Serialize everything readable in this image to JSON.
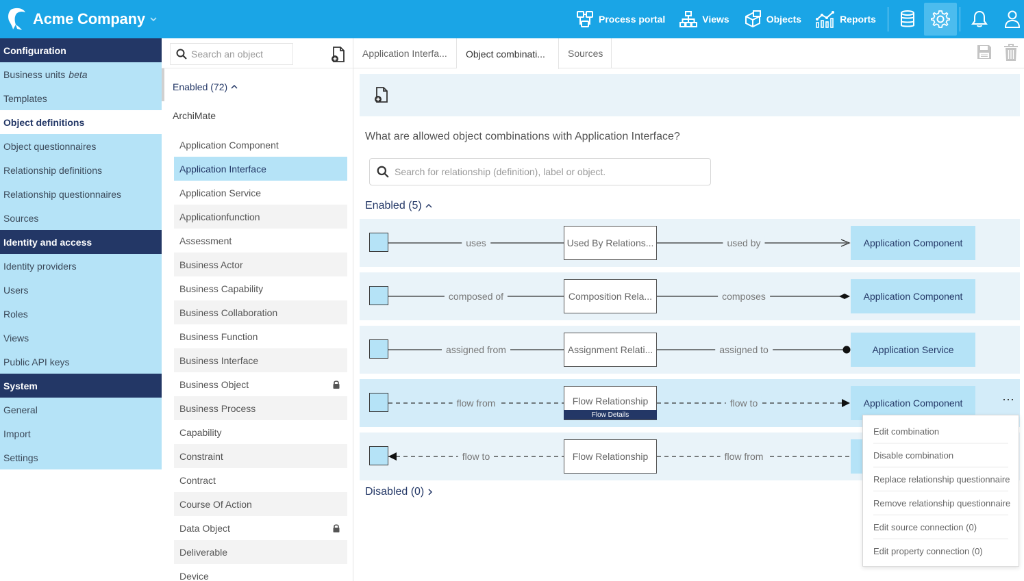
{
  "header": {
    "company": "Acme Company",
    "nav": [
      {
        "label": "Process portal",
        "icon": "process-portal-icon"
      },
      {
        "label": "Views",
        "icon": "views-icon"
      },
      {
        "label": "Objects",
        "icon": "objects-icon"
      },
      {
        "label": "Reports",
        "icon": "reports-icon"
      }
    ],
    "icons": [
      "database-icon",
      "gear-icon",
      "bell-icon",
      "user-icon"
    ],
    "accent": "#1aa5e6"
  },
  "sidebar": {
    "sections": [
      {
        "title": "Configuration",
        "items": [
          {
            "label": "Business units",
            "tag": "beta"
          },
          {
            "label": "Templates"
          },
          {
            "label": "Object definitions",
            "active": true
          },
          {
            "label": "Object questionnaires"
          },
          {
            "label": "Relationship definitions"
          },
          {
            "label": "Relationship questionnaires"
          },
          {
            "label": "Sources"
          }
        ]
      },
      {
        "title": "Identity and access",
        "items": [
          {
            "label": "Identity providers"
          },
          {
            "label": "Users"
          },
          {
            "label": "Roles"
          },
          {
            "label": "Views"
          },
          {
            "label": "Public API keys"
          }
        ]
      },
      {
        "title": "System",
        "items": [
          {
            "label": "General"
          },
          {
            "label": "Import"
          },
          {
            "label": "Settings"
          }
        ]
      }
    ]
  },
  "objects": {
    "search_placeholder": "Search an object",
    "enabled_label": "Enabled (72)",
    "group": "ArchiMate",
    "items": [
      {
        "label": "Application Component"
      },
      {
        "label": "Application Interface",
        "selected": true
      },
      {
        "label": "Application Service"
      },
      {
        "label": "Applicationfunction"
      },
      {
        "label": "Assessment"
      },
      {
        "label": "Business Actor"
      },
      {
        "label": "Business Capability"
      },
      {
        "label": "Business Collaboration"
      },
      {
        "label": "Business Function"
      },
      {
        "label": "Business Interface"
      },
      {
        "label": "Business Object",
        "locked": true
      },
      {
        "label": "Business Process"
      },
      {
        "label": "Capability"
      },
      {
        "label": "Constraint"
      },
      {
        "label": "Contract"
      },
      {
        "label": "Course Of Action"
      },
      {
        "label": "Data Object",
        "locked": true
      },
      {
        "label": "Deliverable"
      },
      {
        "label": "Device"
      }
    ]
  },
  "tabs": [
    {
      "label": "Application Interfa..."
    },
    {
      "label": "Object combinati...",
      "active": true
    },
    {
      "label": "Sources"
    }
  ],
  "main": {
    "question": "What are allowed object combinations with Application Interface?",
    "search_placeholder": "Search for relationship (definition), label or object.",
    "enabled_label": "Enabled (5)",
    "disabled_label": "Disabled (0)",
    "combinations": [
      {
        "from_label": "uses",
        "relationship": "Used By Relations...",
        "to_label": "used by",
        "target": "Application Component",
        "style": "solid",
        "end": "arrow-open"
      },
      {
        "from_label": "composed of",
        "relationship": "Composition Rela...",
        "to_label": "composes",
        "target": "Application Component",
        "style": "solid",
        "end": "diamond"
      },
      {
        "from_label": "assigned from",
        "relationship": "Assignment Relati...",
        "to_label": "assigned to",
        "target": "Application Service",
        "style": "solid",
        "end": "dot"
      },
      {
        "from_label": "flow from",
        "relationship": "Flow Relationship",
        "sub": "Flow Details",
        "to_label": "flow to",
        "target": "Application Component",
        "style": "dashed",
        "end": "arrow-filled",
        "highlighted": true
      },
      {
        "from_label": "flow to",
        "relationship": "Flow Relationship",
        "to_label": "flow from",
        "target": "",
        "style": "dashed",
        "end": "none",
        "start": "arrow-filled"
      }
    ]
  },
  "context_menu": {
    "items": [
      "Edit combination",
      "Disable combination",
      "Replace relationship questionnaire",
      "Remove relationship questionnaire",
      "Edit source connection (0)",
      "Edit property connection (0)"
    ]
  }
}
